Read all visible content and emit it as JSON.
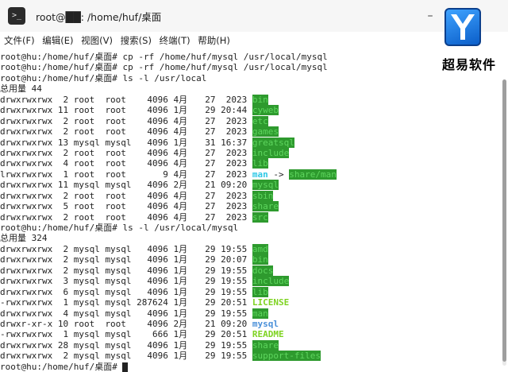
{
  "window": {
    "title": "root@██: /home/huf/桌面",
    "minimize": "–",
    "maximize": "☐",
    "close": "✕"
  },
  "brand": {
    "name": "超易软件"
  },
  "menu": [
    "文件(F)",
    "编辑(E)",
    "视图(V)",
    "搜索(S)",
    "终端(T)",
    "帮助(H)"
  ],
  "terminal": {
    "lines": [
      {
        "type": "cmd",
        "prompt": "root@hu:/home/huf/桌面#",
        "text": " cp -rf /home/huf/mysql /usr/local/mysql"
      },
      {
        "type": "cmd",
        "prompt": "root@hu:/home/huf/桌面#",
        "text": " cp -rf /home/huf/mysql /usr/local/mysql"
      },
      {
        "type": "cmd",
        "prompt": "root@hu:/home/huf/桌面#",
        "text": " ls -l /usr/local"
      },
      {
        "type": "text",
        "text": "总用量 44"
      },
      {
        "type": "entry",
        "perm": "drwxrwxrwx",
        "links": "2",
        "owner": "root",
        "group": "root",
        "size": "4096",
        "month": "4月",
        "day": "27",
        "time": "2023",
        "name": "bin",
        "style": "hl"
      },
      {
        "type": "entry",
        "perm": "drwxrwxrwx",
        "links": "11",
        "owner": "root",
        "group": "root",
        "size": "4096",
        "month": "1月",
        "day": "29",
        "time": "20:44",
        "name": "cyweb",
        "style": "hl"
      },
      {
        "type": "entry",
        "perm": "drwxrwxrwx",
        "links": "2",
        "owner": "root",
        "group": "root",
        "size": "4096",
        "month": "4月",
        "day": "27",
        "time": "2023",
        "name": "etc",
        "style": "hl"
      },
      {
        "type": "entry",
        "perm": "drwxrwxrwx",
        "links": "2",
        "owner": "root",
        "group": "root",
        "size": "4096",
        "month": "4月",
        "day": "27",
        "time": "2023",
        "name": "games",
        "style": "hl"
      },
      {
        "type": "entry",
        "perm": "drwxrwxrwx",
        "links": "13",
        "owner": "mysql",
        "group": "mysql",
        "size": "4096",
        "month": "1月",
        "day": "31",
        "time": "16:37",
        "name": "greatsql",
        "style": "hl"
      },
      {
        "type": "entry",
        "perm": "drwxrwxrwx",
        "links": "2",
        "owner": "root",
        "group": "root",
        "size": "4096",
        "month": "4月",
        "day": "27",
        "time": "2023",
        "name": "include",
        "style": "hl"
      },
      {
        "type": "entry",
        "perm": "drwxrwxrwx",
        "links": "4",
        "owner": "root",
        "group": "root",
        "size": "4096",
        "month": "4月",
        "day": "27",
        "time": "2023",
        "name": "lib",
        "style": "hl"
      },
      {
        "type": "entry",
        "perm": "lrwxrwxrwx",
        "links": "1",
        "owner": "root",
        "group": "root",
        "size": "9",
        "month": "4月",
        "day": "27",
        "time": "2023",
        "name": "man",
        "style": "cyan",
        "arrow": " -> ",
        "target": "share/man"
      },
      {
        "type": "entry",
        "perm": "drwxrwxrwx",
        "links": "11",
        "owner": "mysql",
        "group": "mysql",
        "size": "4096",
        "month": "2月",
        "day": "21",
        "time": "09:20",
        "name": "mysql",
        "style": "hl"
      },
      {
        "type": "entry",
        "perm": "drwxrwxrwx",
        "links": "2",
        "owner": "root",
        "group": "root",
        "size": "4096",
        "month": "4月",
        "day": "27",
        "time": "2023",
        "name": "sbin",
        "style": "hl"
      },
      {
        "type": "entry",
        "perm": "drwxrwxrwx",
        "links": "5",
        "owner": "root",
        "group": "root",
        "size": "4096",
        "month": "4月",
        "day": "27",
        "time": "2023",
        "name": "share",
        "style": "hl"
      },
      {
        "type": "entry",
        "perm": "drwxrwxrwx",
        "links": "2",
        "owner": "root",
        "group": "root",
        "size": "4096",
        "month": "4月",
        "day": "27",
        "time": "2023",
        "name": "src",
        "style": "hl"
      },
      {
        "type": "cmd",
        "prompt": "root@hu:/home/huf/桌面#",
        "text": " ls -l /usr/local/mysql"
      },
      {
        "type": "text",
        "text": "总用量 324"
      },
      {
        "type": "entry",
        "perm": "drwxrwxrwx",
        "links": "2",
        "owner": "mysql",
        "group": "mysql",
        "size": "4096",
        "month": "1月",
        "day": "29",
        "time": "19:55",
        "name": "amd",
        "style": "hl"
      },
      {
        "type": "entry",
        "perm": "drwxrwxrwx",
        "links": "2",
        "owner": "mysql",
        "group": "mysql",
        "size": "4096",
        "month": "1月",
        "day": "29",
        "time": "20:07",
        "name": "bin",
        "style": "hl"
      },
      {
        "type": "entry",
        "perm": "drwxrwxrwx",
        "links": "2",
        "owner": "mysql",
        "group": "mysql",
        "size": "4096",
        "month": "1月",
        "day": "29",
        "time": "19:55",
        "name": "docs",
        "style": "hl"
      },
      {
        "type": "entry",
        "perm": "drwxrwxrwx",
        "links": "3",
        "owner": "mysql",
        "group": "mysql",
        "size": "4096",
        "month": "1月",
        "day": "29",
        "time": "19:55",
        "name": "include",
        "style": "hl"
      },
      {
        "type": "entry",
        "perm": "drwxrwxrwx",
        "links": "6",
        "owner": "mysql",
        "group": "mysql",
        "size": "4096",
        "month": "1月",
        "day": "29",
        "time": "19:55",
        "name": "lib",
        "style": "hl"
      },
      {
        "type": "entry",
        "perm": "-rwxrwxrwx",
        "links": "1",
        "owner": "mysql",
        "group": "mysql",
        "size": "287624",
        "month": "1月",
        "day": "29",
        "time": "20:51",
        "name": "LICENSE",
        "style": "green"
      },
      {
        "type": "entry",
        "perm": "drwxrwxrwx",
        "links": "4",
        "owner": "mysql",
        "group": "mysql",
        "size": "4096",
        "month": "1月",
        "day": "29",
        "time": "19:55",
        "name": "man",
        "style": "hl"
      },
      {
        "type": "entry",
        "perm": "drwxr-xr-x",
        "links": "10",
        "owner": "root",
        "group": "root",
        "size": "4096",
        "month": "2月",
        "day": "21",
        "time": "09:20",
        "name": "mysql",
        "style": "blue"
      },
      {
        "type": "entry",
        "perm": "-rwxrwxrwx",
        "links": "1",
        "owner": "mysql",
        "group": "mysql",
        "size": "666",
        "month": "1月",
        "day": "29",
        "time": "20:51",
        "name": "README",
        "style": "green"
      },
      {
        "type": "entry",
        "perm": "drwxrwxrwx",
        "links": "28",
        "owner": "mysql",
        "group": "mysql",
        "size": "4096",
        "month": "1月",
        "day": "29",
        "time": "19:55",
        "name": "share",
        "style": "hl"
      },
      {
        "type": "entry",
        "perm": "drwxrwxrwx",
        "links": "2",
        "owner": "mysql",
        "group": "mysql",
        "size": "4096",
        "month": "1月",
        "day": "29",
        "time": "19:55",
        "name": "support-files",
        "style": "hl"
      },
      {
        "type": "cmd",
        "prompt": "root@hu:/home/huf/桌面#",
        "text": " "
      }
    ]
  },
  "colors": {
    "dir_highlight_bg": "#2e9a2e",
    "dir_highlight_fg": "#5ed65e",
    "symlink": "#2ec8e6",
    "executable": "#7ed321",
    "plain_dir": "#4a90d9"
  }
}
